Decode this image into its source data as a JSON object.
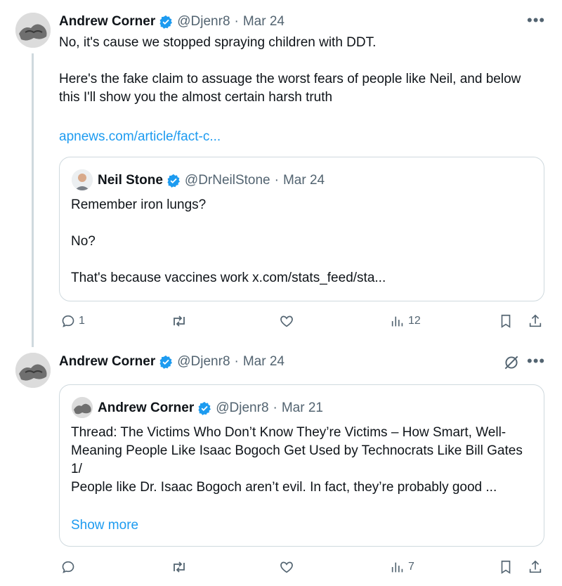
{
  "tweet1": {
    "author_name": "Andrew Corner",
    "handle": "@Djenr8",
    "sep": "·",
    "date": "Mar 24",
    "body": "No, it's cause we stopped spraying children with DDT.\n\nHere's the fake claim to assuage the worst fears of people like Neil, and below this I'll show you the almost certain harsh truth",
    "link": "apnews.com/article/fact-c...",
    "more_icon": "more-horizontal-icon",
    "quote": {
      "author_name": "Neil Stone",
      "handle": "@DrNeilStone",
      "sep": "·",
      "date": "Mar 24",
      "body": "Remember iron lungs?\n\nNo?\n\nThat's because vaccines work x.com/stats_feed/sta..."
    },
    "actions": {
      "replies": "1",
      "reposts": "",
      "likes": "",
      "views": "12"
    }
  },
  "tweet2": {
    "author_name": "Andrew Corner",
    "handle": "@Djenr8",
    "sep": "·",
    "date": "Mar 24",
    "grok_icon": "grok-slash-icon",
    "quote": {
      "author_name": "Andrew Corner",
      "handle": "@Djenr8",
      "sep": "·",
      "date": "Mar 21",
      "body": "Thread: The Victims Who Don’t Know They’re Victims – How Smart, Well-Meaning People Like Isaac Bogoch Get Used by Technocrats Like Bill Gates\n1/\nPeople like Dr. Isaac Bogoch aren’t evil. In fact, they’re probably good ...",
      "show_more": "Show more"
    },
    "actions": {
      "replies": "",
      "reposts": "",
      "likes": "",
      "views": "7"
    }
  },
  "colors": {
    "accent": "#1d9bf0",
    "muted": "#536471",
    "border": "#cfd9de"
  }
}
